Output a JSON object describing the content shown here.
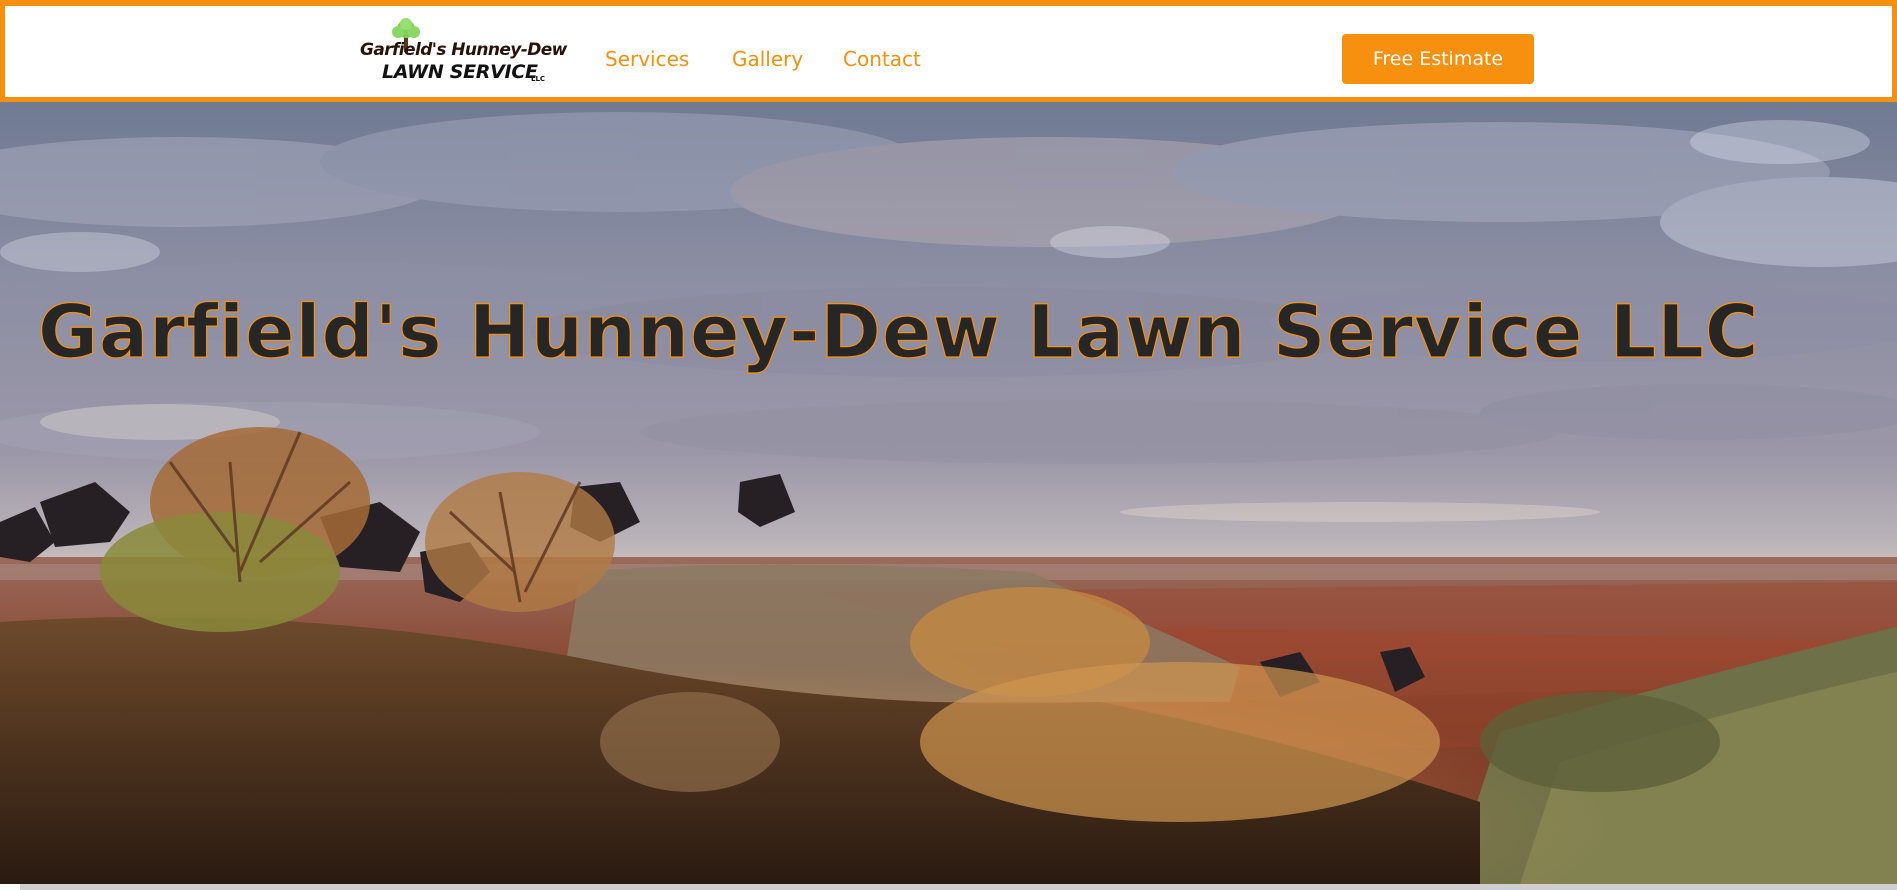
{
  "brand": {
    "logo_line1": "Garfield's Hunney-Dew",
    "logo_line2": "LAWN SERVICE",
    "logo_suffix": "LLC",
    "logo_icon": "tree-icon",
    "accent_color": "#f7900f"
  },
  "nav": {
    "links": [
      {
        "label": "Services"
      },
      {
        "label": "Gallery"
      },
      {
        "label": "Contact"
      }
    ],
    "cta_label": "Free Estimate"
  },
  "hero": {
    "title": "Garfield's Hunney-Dew Lawn Service LLC"
  }
}
